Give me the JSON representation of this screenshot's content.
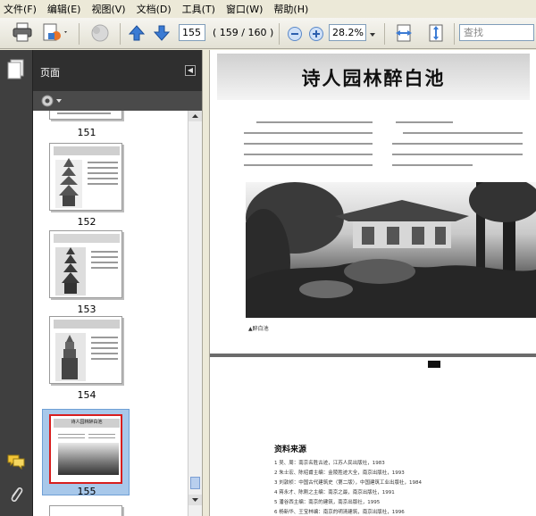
{
  "menu": [
    "文件(F)",
    "编辑(E)",
    "视图(V)",
    "文档(D)",
    "工具(T)",
    "窗口(W)",
    "帮助(H)"
  ],
  "toolbar": {
    "page_number": "155",
    "page_count": "( 159 / 160 )",
    "zoom": "28.2%",
    "search_placeholder": "查找"
  },
  "panel": {
    "title": "页面",
    "thumbnails": [
      {
        "label": "151",
        "heading": ""
      },
      {
        "label": "152",
        "heading": ""
      },
      {
        "label": "153",
        "heading": ""
      },
      {
        "label": "154",
        "heading": ""
      },
      {
        "label": "155",
        "heading": "诗人园林醉白池"
      }
    ],
    "selected": "155"
  },
  "document": {
    "page_title": "诗人园林醉白池",
    "photo_caption": "▲醉白池",
    "references_title": "资料来源",
    "references": [
      "1  吴、周：南京名胜古迹，江苏人民出版社，1983",
      "2  朱士宏、陈绍甫主编：金陵胜迹大全，南京出版社，1993",
      "3  刘敦桢：中国古代建筑史（第二版），中国建筑工业出版社，1984",
      "4  蒋永才、陈刚之主编：南京之最，南京出版社，1991",
      "5  潘谷西主编：南京的建筑，南京出版社，1995",
      "6  杨新华、王宝林编：南京的明清建筑，南京出版社，1996"
    ]
  }
}
